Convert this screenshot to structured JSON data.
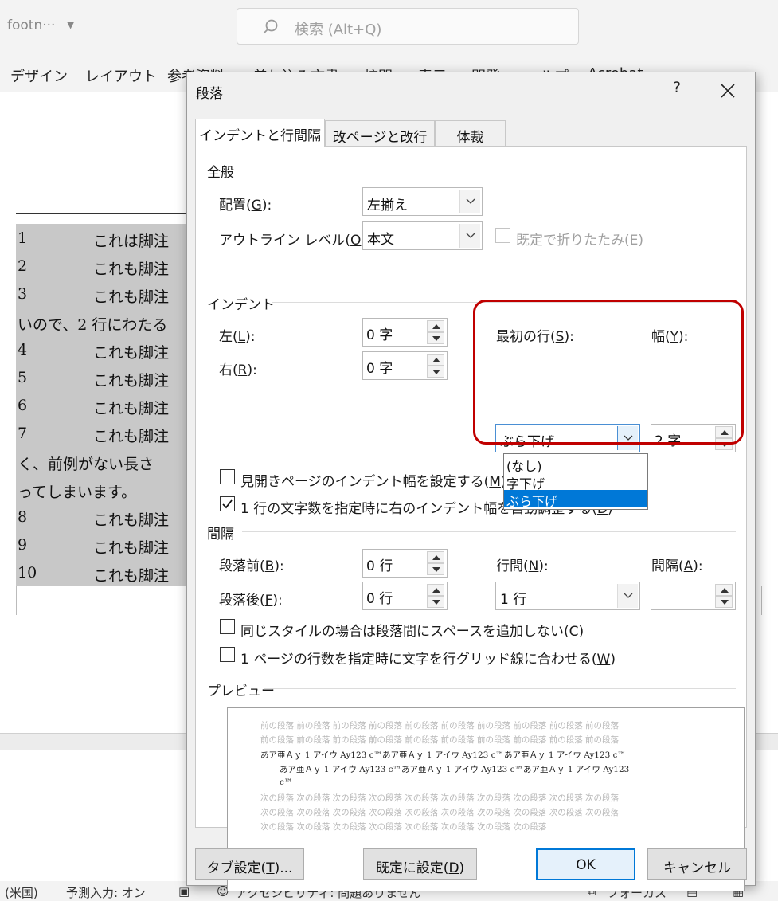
{
  "word": {
    "doc_name": "footn···",
    "search_placeholder": "検索 (Alt+Q)",
    "ribbon_tabs": [
      "デザイン",
      "レイアウト",
      "参考資料",
      "差し込み文書",
      "校閲",
      "表示",
      "開発",
      "ヘルプ",
      "Acrobat"
    ],
    "footnotes": [
      {
        "num": "1",
        "text": "これは脚注"
      },
      {
        "num": "2",
        "text": "これも脚注"
      },
      {
        "num": "3",
        "text": "これも脚注"
      },
      {
        "num": "",
        "text": "いので、2 行にわたる"
      },
      {
        "num": "4",
        "text": "これも脚注"
      },
      {
        "num": "5",
        "text": "これも脚注"
      },
      {
        "num": "6",
        "text": "これも脚注"
      },
      {
        "num": "7",
        "text": "これも脚注"
      },
      {
        "num": "",
        "text": "く、前例がない長さ"
      },
      {
        "num": "",
        "text": "ってしまいます。"
      },
      {
        "num": "8",
        "text": "これも脚注"
      },
      {
        "num": "9",
        "text": "これも脚注"
      },
      {
        "num": "10",
        "text": "これも脚注"
      }
    ],
    "status": {
      "language": "(米国)",
      "predict": "予測入力: オン",
      "accessibility": "アクセシビリティ: 問題ありません",
      "focus": "フォーカス"
    }
  },
  "dialog": {
    "title": "段落",
    "help": "?",
    "tabs": [
      "インデントと行間隔",
      "改ページと改行",
      "体裁"
    ],
    "general": {
      "title": "全般",
      "alignment_label": "配置(",
      "alignment_key": "G",
      "alignment_suffix": "):",
      "alignment_value": "左揃え",
      "outline_label": "アウトライン レベル(",
      "outline_key": "O",
      "outline_suffix": "):",
      "outline_value": "本文",
      "collapse_label": "既定で折りたたみ(E)"
    },
    "indent": {
      "title": "インデント",
      "left_label": "左(",
      "left_key": "L",
      "left_suffix": "):",
      "left_value": "0 字",
      "right_label": "右(",
      "right_key": "R",
      "right_suffix": "):",
      "right_value": "0 字",
      "first_line_label": "最初の行(",
      "first_line_key": "S",
      "first_line_suffix": "):",
      "first_line_value": "ぶら下げ",
      "width_label": "幅(",
      "width_key": "Y",
      "width_suffix": "):",
      "width_value": "2 字",
      "options": [
        "(なし)",
        "字下げ",
        "ぶら下げ"
      ],
      "mirror_label": "見開きページのインデント幅を設定する(",
      "mirror_key": "M",
      "mirror_suffix": ")",
      "auto_adjust_label": "1 行の文字数を指定時に右のインデント幅を自動調整する(",
      "auto_adjust_key": "D",
      "auto_adjust_suffix": ")"
    },
    "spacing": {
      "title": "間隔",
      "before_label": "段落前(",
      "before_key": "B",
      "before_suffix": "):",
      "before_value": "0 行",
      "after_label": "段落後(",
      "after_key": "F",
      "after_suffix": "):",
      "after_value": "0 行",
      "line_label": "行間(",
      "line_key": "N",
      "line_suffix": "):",
      "line_value": "1 行",
      "at_label": "間隔(",
      "at_key": "A",
      "at_suffix": "):",
      "at_value": "",
      "no_space_label": "同じスタイルの場合は段落間にスペースを追加しない(",
      "no_space_key": "C",
      "no_space_suffix": ")",
      "snap_grid_label": "1 ページの行数を指定時に文字を行グリッド線に合わせる(",
      "snap_grid_key": "W",
      "snap_grid_suffix": ")"
    },
    "preview": {
      "title": "プレビュー",
      "prev_lines": [
        "前の段落  前の段落  前の段落  前の段落  前の段落  前の段落  前の段落  前の段落  前の段落  前の段落",
        "前の段落  前の段落  前の段落  前の段落  前の段落  前の段落  前の段落  前の段落  前の段落  前の段落"
      ],
      "sample_lines": [
        "あア亜Ａｙ  1   アイウ   Ay123 c™あア亜Ａｙ  1   アイウ   Ay123 c™あア亜Ａｙ  1   アイウ   Ay123 c™",
        "あア亜Ａｙ  1   アイウ   Ay123 c™あア亜Ａｙ  1   アイウ   Ay123 c™あア亜Ａｙ  1   アイウ   Ay123",
        "c™"
      ],
      "next_lines": [
        "次の段落  次の段落  次の段落  次の段落  次の段落  次の段落  次の段落  次の段落  次の段落  次の段落",
        "次の段落  次の段落  次の段落  次の段落  次の段落  次の段落  次の段落  次の段落  次の段落  次の段落",
        "次の段落  次の段落  次の段落  次の段落  次の段落  次の段落  次の段落  次の段落"
      ]
    },
    "buttons": {
      "tabs_label": "タブ設定(",
      "tabs_key": "T",
      "tabs_suffix": ")...",
      "default_label": "既定に設定(",
      "default_key": "D",
      "default_suffix": ")",
      "ok": "OK",
      "cancel": "キャンセル"
    }
  },
  "colors": {
    "selection": "#0078d7",
    "annotation_circle": "#c00000"
  }
}
